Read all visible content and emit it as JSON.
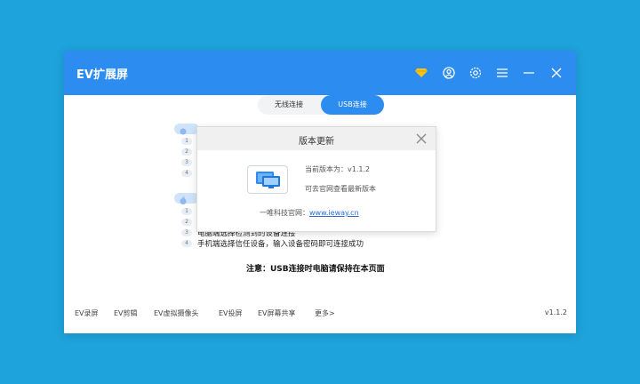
{
  "app": {
    "title": "EV扩展屏"
  },
  "tabs": {
    "wireless": "无线连接",
    "usb": "USB连接"
  },
  "steps": [
    {
      "num": "3",
      "text": "电脑端选择检测到的设备连接"
    },
    {
      "num": "4",
      "text": "手机端选择信任设备，输入设备密码即可连接成功"
    }
  ],
  "hidden_numbers": [
    "1",
    "2",
    "3",
    "4",
    "1",
    "2"
  ],
  "note": "注意：USB连接时电脑请保持在本页面",
  "footer": {
    "items": [
      "EV录屏",
      "EV剪辑",
      "EV虚拟摄像头",
      "EV投屏",
      "EV屏幕共享",
      "更多>"
    ],
    "version": "v1.1.2"
  },
  "dialog": {
    "title": "版本更新",
    "current_version": "当前版本为：v1.1.2",
    "hint": "可去官网查看最新版本",
    "site_label": "一唯科技官网：",
    "site_link": "www.ieway.cn"
  },
  "colors": {
    "accent": "#2d8cf0",
    "background": "#1ea3dc"
  },
  "icons": [
    "diamond-icon",
    "user-icon",
    "settings-icon",
    "menu-icon",
    "minimize-icon",
    "close-icon"
  ]
}
